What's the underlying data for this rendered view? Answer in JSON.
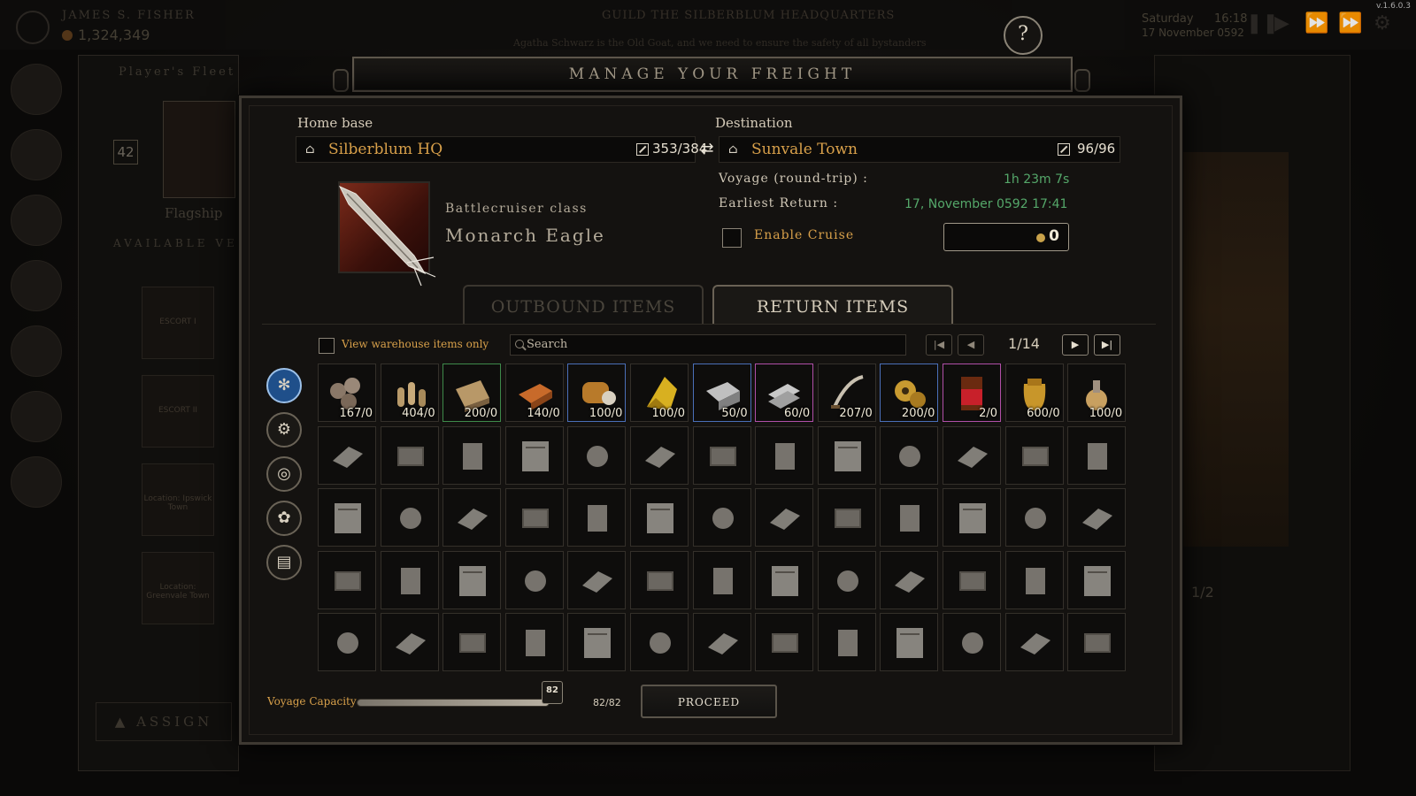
{
  "background": {
    "player_name": "JAMES S. FISHER",
    "money": "1,324,349",
    "quest_title": "GUILD THE SILBERBLUM HEADQUARTERS",
    "quest_subtitle": "Agatha Schwarz is the Old Goat, and we need to ensure the safety of all bystanders",
    "day": "Saturday",
    "date": "17 November 0592",
    "time": "16:18",
    "version": "v.1.6.0.3",
    "fleet_title": "Player's Fleet",
    "fleet_count": "42",
    "flagship_label": "Flagship",
    "available_label": "AVAILABLE VE",
    "escorts": [
      "ESCORT I",
      "ESCORT II",
      "Location: Ipswick Town",
      "Location: Greenvale Town"
    ],
    "assign_label": "ASSIGN",
    "right_page": "1/2"
  },
  "dialog": {
    "title": "MANAGE YOUR FREIGHT",
    "home": {
      "label": "Home base",
      "name": "Silberblum HQ",
      "capacity": "353/384"
    },
    "destination": {
      "label": "Destination",
      "name": "Sunvale Town",
      "capacity": "96/96"
    },
    "ship": {
      "class": "Battlecruiser class",
      "name": "Monarch Eagle"
    },
    "voyage": {
      "roundtrip_label": "Voyage (round-trip) :",
      "roundtrip_value": "1h 23m 7s",
      "return_label": "Earliest Return :",
      "return_value": "17, November 0592 17:41"
    },
    "cruise": {
      "label": "Enable Cruise",
      "checked": false,
      "cost": "0"
    },
    "tabs": [
      {
        "label": "OUTBOUND ITEMS",
        "active": false
      },
      {
        "label": "RETURN ITEMS",
        "active": true
      }
    ],
    "warehouse_only_label": "View warehouse items only",
    "search_placeholder": "Search",
    "page": "1/14",
    "categories": [
      "snowflake-icon",
      "gear-icon",
      "resources-icon",
      "settings-icon",
      "book-icon"
    ],
    "items_row1": [
      {
        "icon": "iron-balls",
        "count": "167/0",
        "rarity": ""
      },
      {
        "icon": "bullets",
        "count": "404/0",
        "rarity": ""
      },
      {
        "icon": "timber",
        "count": "200/0",
        "rarity": "green"
      },
      {
        "icon": "copper-ingot",
        "count": "140/0",
        "rarity": ""
      },
      {
        "icon": "gear-tank",
        "count": "100/0",
        "rarity": "blue"
      },
      {
        "icon": "gold-cloth",
        "count": "100/0",
        "rarity": ""
      },
      {
        "icon": "steel-block",
        "count": "50/0",
        "rarity": "blue"
      },
      {
        "icon": "silver-bars",
        "count": "60/0",
        "rarity": "purple"
      },
      {
        "icon": "sword",
        "count": "207/0",
        "rarity": ""
      },
      {
        "icon": "golden-gears",
        "count": "200/0",
        "rarity": "blue"
      },
      {
        "icon": "chocolate-bar",
        "count": "2/0",
        "rarity": "purple"
      },
      {
        "icon": "grain-sack",
        "count": "600/0",
        "rarity": ""
      },
      {
        "icon": "potion-flask",
        "count": "100/0",
        "rarity": ""
      }
    ],
    "capacity_label": "Voyage Capacity",
    "capacity_current": 82,
    "capacity_max": 82,
    "capacity_knob": "82",
    "capacity_text": "82/82",
    "proceed_label": "PROCEED"
  }
}
